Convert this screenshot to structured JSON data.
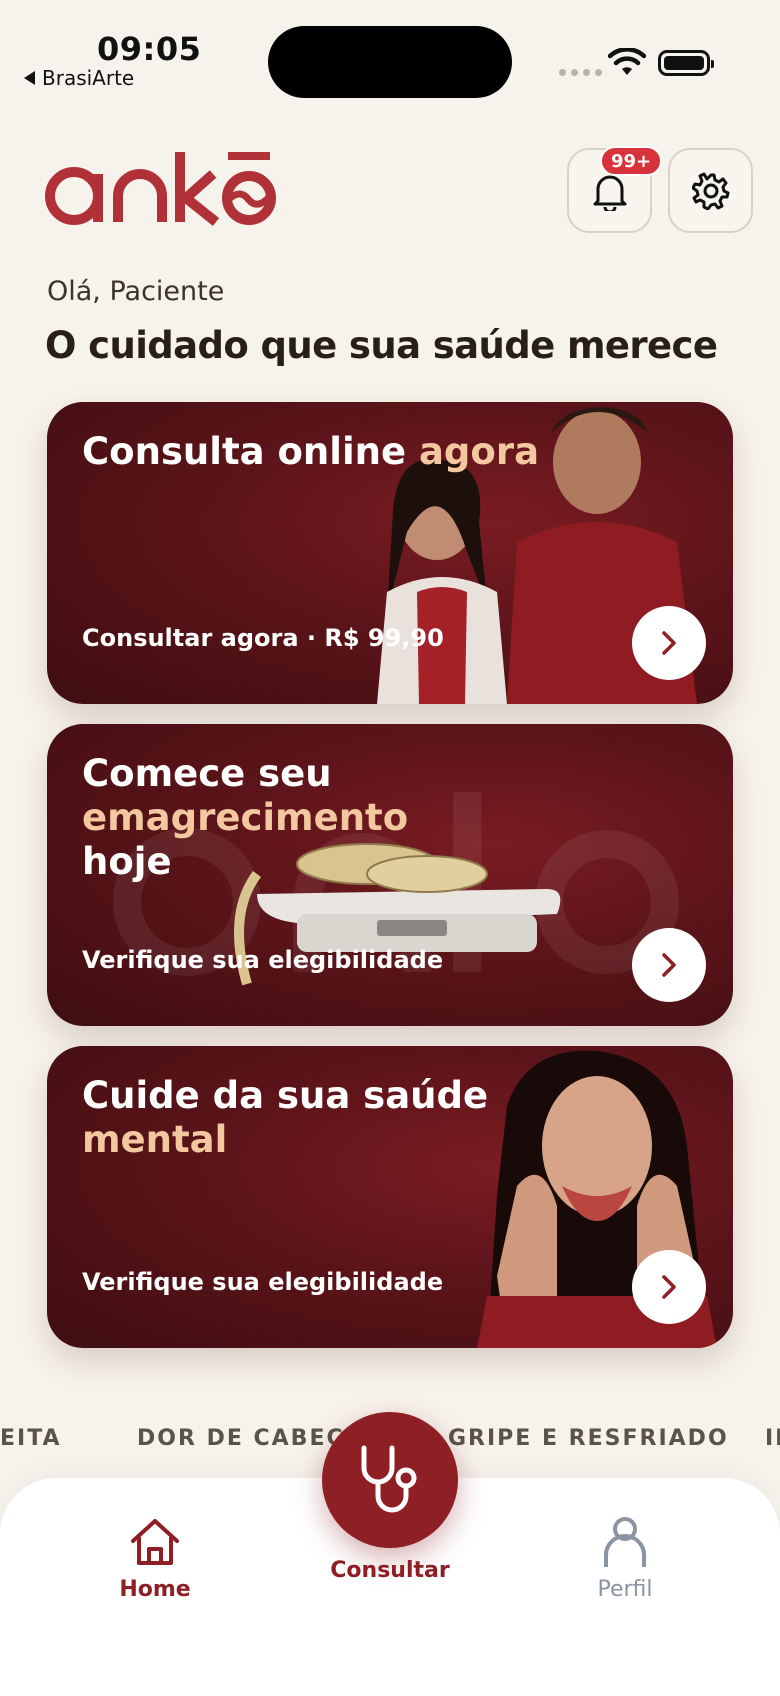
{
  "status_bar": {
    "time": "09:05",
    "back_app": "BrasiArte"
  },
  "header": {
    "logo_text": "ankō",
    "notification_badge": "99+",
    "bell_icon": "bell-icon",
    "settings_icon": "gear-icon"
  },
  "greeting": "Olá, Paciente",
  "headline": "O cuidado que sua saúde merece",
  "cards": [
    {
      "title_plain": "Consulta online ",
      "title_accent": "agora",
      "subtitle": "Consultar agora · R$ 99,90"
    },
    {
      "title_plain": "Comece seu ",
      "title_accent": "emagrecimento",
      "title_tail": "hoje",
      "subtitle": "Verifique sua elegibilidade"
    },
    {
      "title_plain": "Cuide da sua saúde ",
      "title_accent": "mental",
      "subtitle": "Verifique sua elegibilidade"
    }
  ],
  "ticker": [
    "EITA",
    "DOR DE CABEÇA",
    "GRIPE E RESFRIADO",
    "IN"
  ],
  "bottom_nav": {
    "home": "Home",
    "consult": "Consultar",
    "profile": "Perfil"
  },
  "colors": {
    "brand": "#b03238",
    "primary_dark": "#8d1f25",
    "accent_text": "#f3c8a1",
    "background": "#f6f3ec"
  }
}
